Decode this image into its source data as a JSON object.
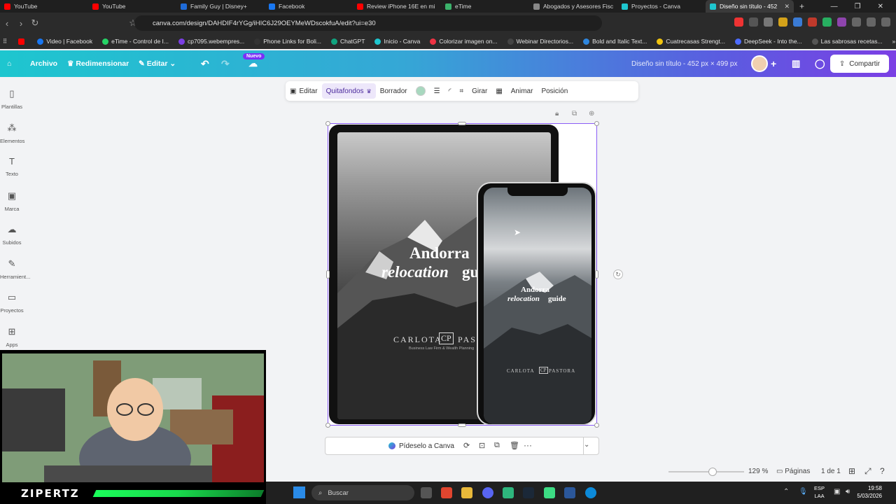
{
  "browser": {
    "tabs": [
      {
        "title": "YouTube",
        "color": "#ff0000"
      },
      {
        "title": "YouTube",
        "color": "#ff0000"
      },
      {
        "title": "Family Guy | Disney+",
        "color": "#1f6bd8"
      },
      {
        "title": "Facebook",
        "color": "#1877f2"
      },
      {
        "title": "Review iPhone 16E en mi",
        "color": "#ff0000"
      },
      {
        "title": "eTime",
        "color": "#3bb26b"
      },
      {
        "title": "Abogados y Asesores Fisc",
        "color": "#888888"
      },
      {
        "title": "Proyectos - Canva",
        "color": "#1ec6cf"
      },
      {
        "title": "Diseño sin título - 452",
        "color": "#1ec6cf",
        "active": true
      }
    ],
    "url": "canva.com/design/DAHDIF4rYGg/iHIC6J29OEYMeWDscokfuA/edit?ui=e30",
    "bookmarks": [
      "Video | Facebook",
      "eTime - Control de I...",
      "cp7095.webempres...",
      "Phone Links for Boli...",
      "ChatGPT",
      "Inicio - Canva",
      "Colorizar imagen on...",
      "Webinar Directorios...",
      "Bold and Italic Text...",
      "Cuatrecasas Strengt...",
      "DeepSeek - Into the...",
      "Las sabrosas recetas..."
    ]
  },
  "canva": {
    "header": {
      "archivo": "Archivo",
      "redimensionar": "Redimensionar",
      "editar": "Editar",
      "nuevo_badge": "Nuevo",
      "doc_title": "Diseño sin título - 452 px × 499 px",
      "share": "Compartir"
    },
    "sidebar": [
      {
        "label": "Plantillas",
        "icon": "templates-icon"
      },
      {
        "label": "Elementos",
        "icon": "elements-icon"
      },
      {
        "label": "Texto",
        "icon": "text-icon"
      },
      {
        "label": "Marca",
        "icon": "brand-icon"
      },
      {
        "label": "Subidos",
        "icon": "uploads-icon"
      },
      {
        "label": "Herramient...",
        "icon": "tools-icon"
      },
      {
        "label": "Proyectos",
        "icon": "projects-icon"
      },
      {
        "label": "Apps",
        "icon": "apps-icon"
      }
    ],
    "toolbar": {
      "editar": "Editar",
      "quitafondos": "Quitafondos",
      "borrador": "Borrador",
      "girar": "Girar",
      "animar": "Animar",
      "posicion": "Posición",
      "color": "#a8d8bf"
    },
    "design": {
      "tablet_title": "Andorra",
      "tablet_subtitle_italic": "relocation",
      "tablet_subtitle_rest": "gu",
      "tablet_brand": "CARLOTA",
      "tablet_brand_rest": "PASTO",
      "tablet_tagline": "Business Law Firm & Wealth Planning",
      "phone_title": "Andorra",
      "phone_subtitle_italic": "relocation",
      "phone_subtitle_rest": "guide",
      "phone_brand": "CARLOTA",
      "phone_brand_rest": "PASTORA"
    },
    "context_bar": {
      "ask": "Pídeselo a Canva"
    },
    "status": {
      "zoom": "129 %",
      "pages_label": "Páginas",
      "page_count": "1 de 1",
      "zoom_level": 0.58
    }
  },
  "webcam": {
    "label": "ZIPERTZ"
  },
  "taskbar": {
    "search_placeholder": "Buscar",
    "lang_top": "ESP",
    "lang_bottom": "LAA",
    "time": "19:58",
    "date": "5/03/2026"
  }
}
